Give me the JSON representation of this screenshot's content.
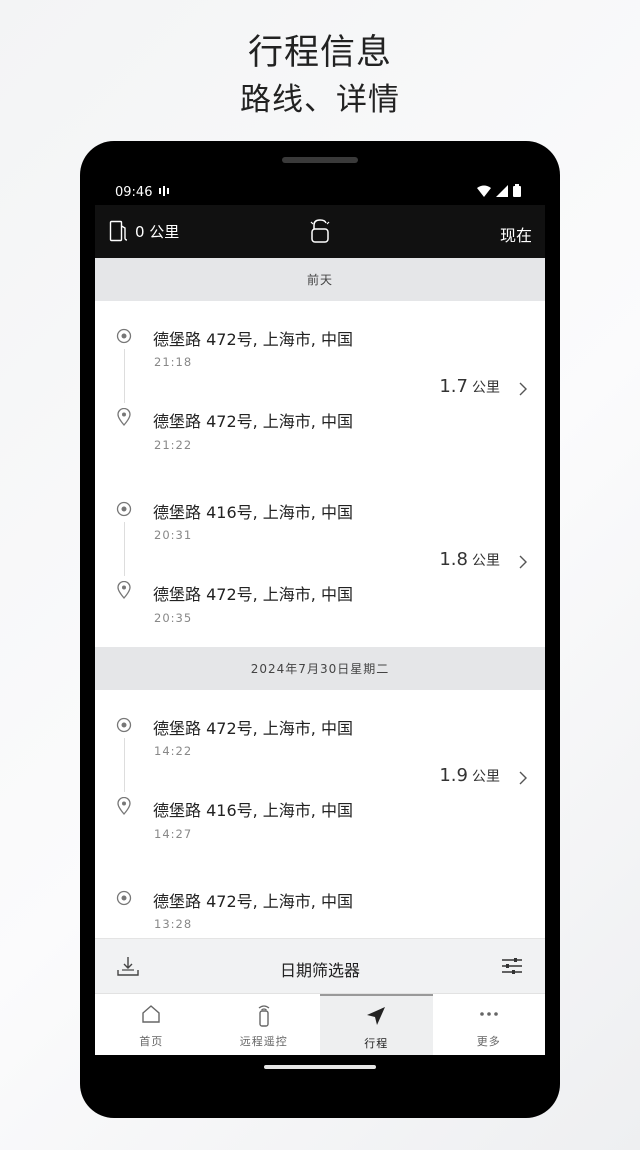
{
  "promo": {
    "title": "行程信息",
    "subtitle": "路线、详情"
  },
  "status_bar": {
    "time": "09:46",
    "notification_icon": "nfc-icon",
    "icons": [
      "wifi-icon",
      "signal-icon",
      "battery-icon"
    ]
  },
  "app_bar": {
    "range_value": "0 公里",
    "range_icon": "fuel-pump-icon",
    "center_icon": "unlock-icon",
    "right_label": "现在"
  },
  "groups": [
    {
      "date": "前天",
      "trips": [
        {
          "start_address": "德堡路 472号, 上海市, 中国",
          "start_time": "21:18",
          "end_address": "德堡路 472号, 上海市, 中国",
          "end_time": "21:22",
          "distance": "1.7",
          "unit": "公里"
        },
        {
          "start_address": "德堡路 416号, 上海市, 中国",
          "start_time": "20:31",
          "end_address": "德堡路 472号, 上海市, 中国",
          "end_time": "20:35",
          "distance": "1.8",
          "unit": "公里"
        }
      ]
    },
    {
      "date": "2024年7月30日星期二",
      "trips": [
        {
          "start_address": "德堡路 472号, 上海市, 中国",
          "start_time": "14:22",
          "end_address": "德堡路 416号, 上海市, 中国",
          "end_time": "14:27",
          "distance": "1.9",
          "unit": "公里"
        },
        {
          "start_address": "德堡路 472号, 上海市, 中国",
          "start_time": "13:28"
        }
      ]
    }
  ],
  "filter_bar": {
    "label": "日期筛选器",
    "left_icon": "download-icon",
    "right_icon": "sliders-icon"
  },
  "bottom_nav": {
    "items": [
      {
        "label": "首页",
        "icon": "home-icon",
        "active": false
      },
      {
        "label": "远程遥控",
        "icon": "remote-key-icon",
        "active": false
      },
      {
        "label": "行程",
        "icon": "navigation-arrow-icon",
        "active": true
      },
      {
        "label": "更多",
        "icon": "more-dots-icon",
        "active": false
      }
    ]
  }
}
